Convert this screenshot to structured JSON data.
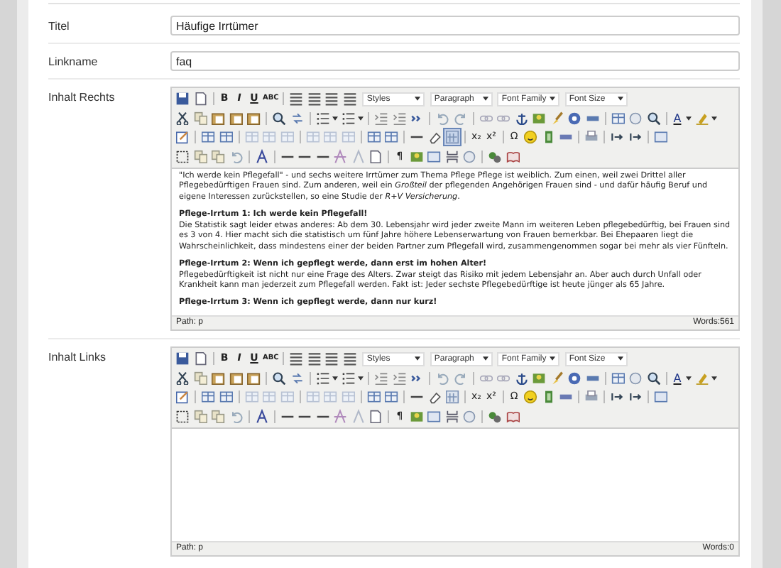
{
  "form": {
    "fields": [
      {
        "kind": "input",
        "label": "Titel",
        "value": "Häufige Irrtümer"
      },
      {
        "kind": "input",
        "label": "Linkname",
        "value": "faq"
      },
      {
        "kind": "editor",
        "label": "Inhalt Rechts",
        "visual_aid_active": true,
        "glyphs": [
          "B",
          "I",
          "U",
          "ABC",
          "A",
          "x₂",
          "x²",
          "Ω",
          "¶"
        ],
        "dropdowns": [
          "Styles",
          "Paragraph",
          "Font Family",
          "Font Size"
        ],
        "content": [
          {
            "kind": "paragraph",
            "text": "\"Ich werde kein Pflegefall\" - und sechs weitere Irrtümer zum Thema Pflege Pflege ist weiblich. Zum einen, weil zwei Drittel aller Pflegebedürftigen Frauen sind. Zum anderen, weil ein *Großteil* der pflegenden Angehörigen Frauen sind - und dafür häufig Beruf und eigene Interessen zurückstellen, so eine Studie der *R+V Versicherung*."
          },
          {
            "kind": "heading",
            "text": "Pflege-Irrtum 1: Ich werde kein Pflegefall!"
          },
          {
            "kind": "paragraph",
            "text": "Die Statistik sagt leider etwas anderes: Ab dem 30. Lebensjahr wird jeder zweite Mann im weiteren Leben pflegebedürftig, bei Frauen sind es 3 von 4. Hier macht sich die statistisch um fünf Jahre höhere Lebenserwartung von Frauen bemerkbar. Bei Ehepaaren liegt die Wahrscheinlichkeit, dass mindestens einer der beiden Partner zum Pflegefall wird, zusammengenommen sogar bei mehr als vier Fünfteln."
          },
          {
            "kind": "heading",
            "text": "Pflege-Irrtum 2: Wenn ich gepflegt werde, dann erst im hohen Alter!"
          },
          {
            "kind": "paragraph",
            "text": "Pflegebedürftigkeit ist nicht nur eine Frage des Alters. Zwar steigt das Risiko mit jedem Lebensjahr an. Aber auch durch Unfall oder Krankheit kann man jederzeit zum Pflegefall werden. Fakt ist: Jeder sechste Pflegebedürftige ist heute jünger als 65 Jahre."
          },
          {
            "kind": "heading",
            "text": "Pflege-Irrtum 3: Wenn ich gepflegt werde, dann nur kurz!"
          }
        ],
        "path": "Path: p",
        "words": "Words:561"
      },
      {
        "kind": "editor",
        "label": "Inhalt Links",
        "visual_aid_active": false,
        "glyphs": [
          "B",
          "I",
          "U",
          "ABC",
          "A",
          "x₂",
          "x²",
          "Ω",
          "¶"
        ],
        "dropdowns": [
          "Styles",
          "Paragraph",
          "Font Family",
          "Font Size"
        ],
        "path": "Path: p",
        "words": "Words:0"
      }
    ]
  }
}
